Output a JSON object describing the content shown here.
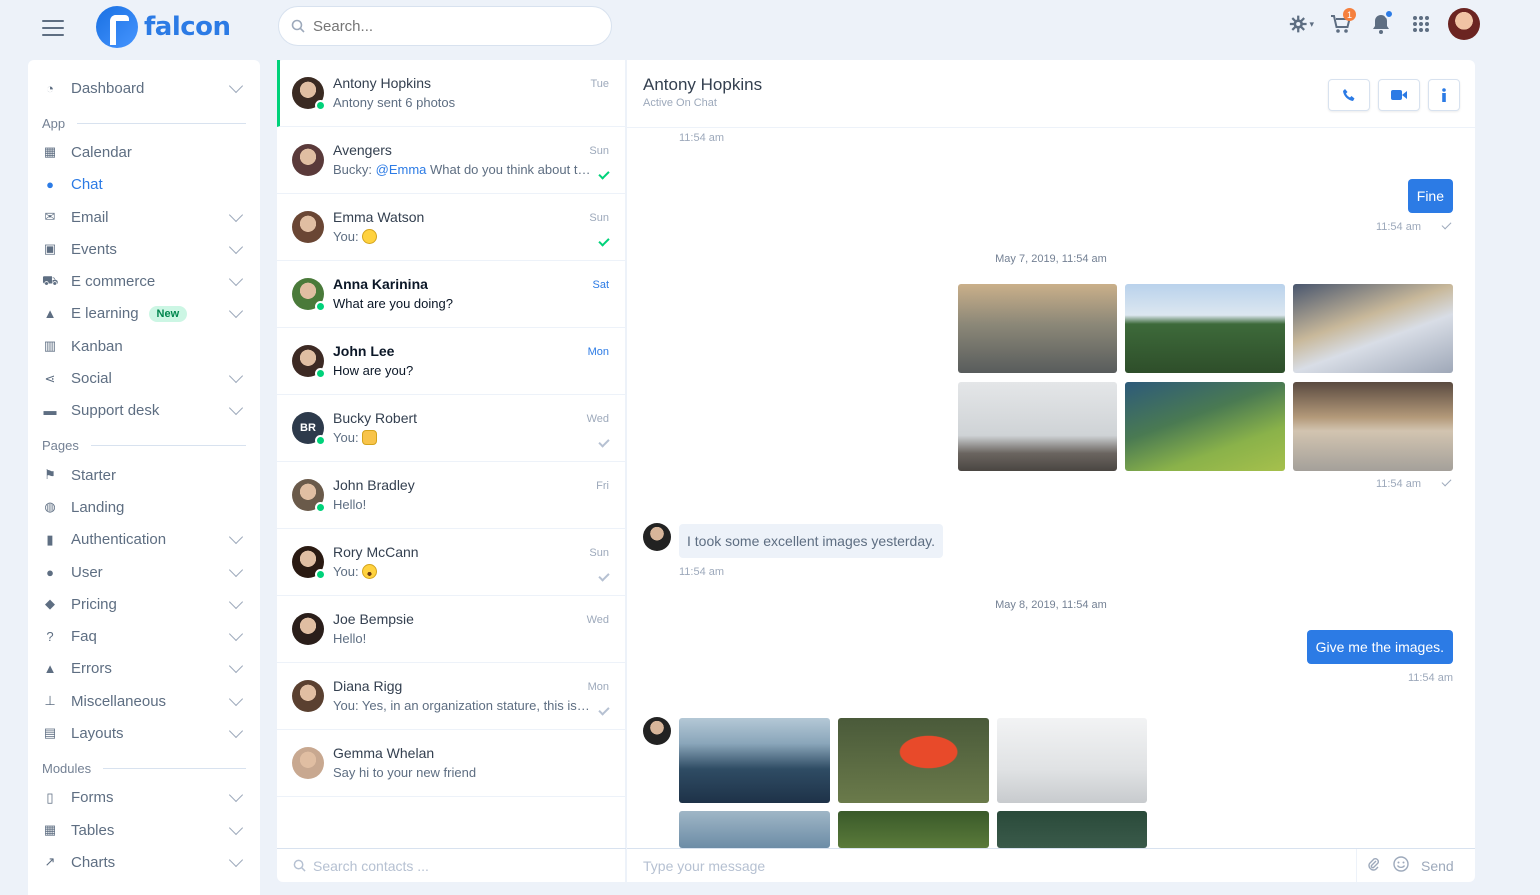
{
  "topbar": {
    "logo_text": "falcon",
    "search_placeholder": "Search...",
    "cart_badge": "1"
  },
  "sidebar": {
    "items": [
      {
        "label": "Dashboard",
        "icon": "pie-chart-icon",
        "chevron": true
      },
      {
        "section": "App"
      },
      {
        "label": "Calendar",
        "icon": "calendar-icon",
        "chevron": false
      },
      {
        "label": "Chat",
        "icon": "comments-icon",
        "chevron": false,
        "active": true
      },
      {
        "label": "Email",
        "icon": "envelope-icon",
        "chevron": true
      },
      {
        "label": "Events",
        "icon": "calendar-day-icon",
        "chevron": true
      },
      {
        "label": "E commerce",
        "icon": "cart-icon",
        "chevron": true
      },
      {
        "label": "E learning",
        "icon": "graduation-cap-icon",
        "chevron": true,
        "badge": "New"
      },
      {
        "label": "Kanban",
        "icon": "columns-icon",
        "chevron": false
      },
      {
        "label": "Social",
        "icon": "share-icon",
        "chevron": true
      },
      {
        "label": "Support desk",
        "icon": "ticket-icon",
        "chevron": true
      },
      {
        "section": "Pages"
      },
      {
        "label": "Starter",
        "icon": "flag-icon",
        "chevron": false
      },
      {
        "label": "Landing",
        "icon": "globe-icon",
        "chevron": false
      },
      {
        "label": "Authentication",
        "icon": "lock-icon",
        "chevron": true
      },
      {
        "label": "User",
        "icon": "user-icon",
        "chevron": true
      },
      {
        "label": "Pricing",
        "icon": "tags-icon",
        "chevron": true
      },
      {
        "label": "Faq",
        "icon": "question-circle-icon",
        "chevron": true
      },
      {
        "label": "Errors",
        "icon": "warning-icon",
        "chevron": true
      },
      {
        "label": "Miscellaneous",
        "icon": "thumbtack-icon",
        "chevron": true
      },
      {
        "label": "Layouts",
        "icon": "window-icon",
        "chevron": true
      },
      {
        "section": "Modules"
      },
      {
        "label": "Forms",
        "icon": "file-icon",
        "chevron": true
      },
      {
        "label": "Tables",
        "icon": "table-icon",
        "chevron": true
      },
      {
        "label": "Charts",
        "icon": "line-chart-icon",
        "chevron": true
      }
    ]
  },
  "threads": [
    {
      "name": "Antony Hopkins",
      "msg": "Antony sent 6 photos",
      "day": "Tue",
      "online": true,
      "active": true,
      "avatar": "#3a2a22"
    },
    {
      "name": "Avengers",
      "msg_prefix": "Bucky: ",
      "mention": "@Emma",
      "msg": " What do you think about the plan?",
      "day": "Sun",
      "tick": "green",
      "avatar": "#5a3a3a"
    },
    {
      "name": "Emma Watson",
      "msg": "You: ",
      "emoji": "smile",
      "day": "Sun",
      "tick": "green",
      "avatar": "#6a4634"
    },
    {
      "name": "Anna Karinina",
      "msg": "What are you doing?",
      "day": "Sat",
      "online": true,
      "bold": true,
      "day_blue": true,
      "avatar": "#4a7a3a"
    },
    {
      "name": "John Lee",
      "msg": "How are you?",
      "day": "Mon",
      "online": true,
      "bold": true,
      "day_blue": true,
      "avatar": "#3d2a24"
    },
    {
      "name": "Bucky Robert",
      "initials": "BR",
      "msg": "You: ",
      "emoji": "wave",
      "day": "Wed",
      "online": true,
      "tick": "grey"
    },
    {
      "name": "John Bradley",
      "msg": "Hello!",
      "day": "Fri",
      "online": true,
      "avatar": "#6a5a4a"
    },
    {
      "name": "Rory McCann",
      "msg": "You: ",
      "emoji": "surprise",
      "day": "Sun",
      "online": true,
      "tick": "grey",
      "avatar": "#2a1a12"
    },
    {
      "name": "Joe Bempsie",
      "msg": "Hello!",
      "day": "Wed",
      "avatar": "#2a1e1a"
    },
    {
      "name": "Diana Rigg",
      "msg": "You: Yes, in an organization stature, this is a very good plan.",
      "day": "Mon",
      "tick": "grey",
      "avatar": "#5a4030"
    },
    {
      "name": "Gemma Whelan",
      "msg": "Say hi to your new friend",
      "day": "",
      "avatar": "#c8a890"
    }
  ],
  "contact_search_placeholder": "Search contacts ...",
  "chat": {
    "name": "Antony Hopkins",
    "status": "Active On Chat",
    "time_top": "11:54 am",
    "msg_fine": "Fine",
    "time_fine": "11:54 am",
    "date1": "May 7, 2019, 11:54 am",
    "time_photos": "11:54 am",
    "msg_images": "I took some excellent images yesterday.",
    "time_images": "11:54 am",
    "date2": "May 8, 2019, 11:54 am",
    "msg_give": "Give me the images.",
    "time_give": "11:54 am",
    "input_placeholder": "Type your message",
    "send_label": "Send"
  }
}
